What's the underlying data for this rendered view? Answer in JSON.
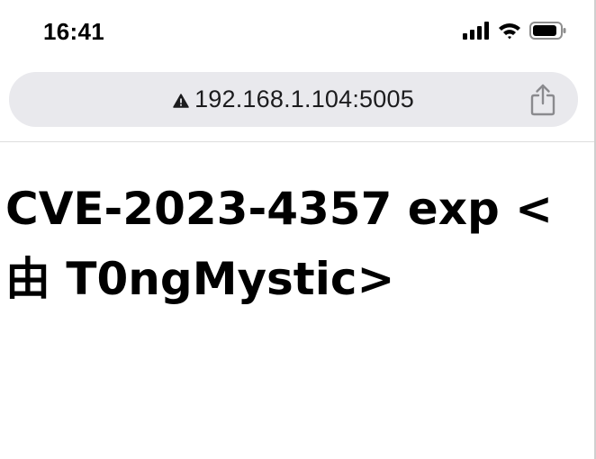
{
  "status_bar": {
    "time": "16:41",
    "icons": [
      "cellular-signal-icon",
      "wifi-icon",
      "battery-icon"
    ]
  },
  "browser": {
    "url": "192.168.1.104:5005",
    "security_icon": "warning-triangle-icon",
    "share_icon": "share-icon"
  },
  "page": {
    "heading": "CVE-2023-4357 exp <由 T0ngMystic>"
  }
}
